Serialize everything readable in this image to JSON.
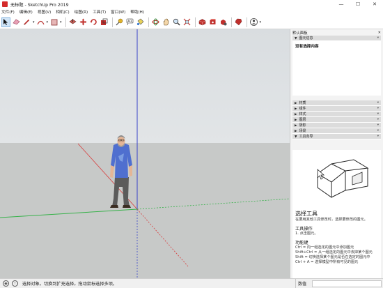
{
  "window": {
    "title": "无标题 - SketchUp Pro 2019",
    "controls": {
      "minimize": "—",
      "maximize": "☐",
      "close": "✕"
    }
  },
  "menu": [
    "文件(F)",
    "编辑(E)",
    "视图(V)",
    "相机(C)",
    "绘图(R)",
    "工具(T)",
    "窗口(W)",
    "帮助(H)"
  ],
  "toolbar": {
    "tools": [
      "select-icon",
      "eraser-icon",
      "pencil-icon",
      "arc-icon",
      "rectangle-icon",
      "push-pull-icon",
      "move-icon",
      "rotate-icon",
      "scale-icon",
      "offset-icon",
      "tape-measure-icon",
      "text-icon",
      "paint-bucket-icon",
      "orbit-icon",
      "pan-icon",
      "zoom-icon",
      "zoom-extents-icon",
      "warehouse-icon",
      "extension-warehouse-icon",
      "extension-manager-icon",
      "ruby-icon",
      "account-icon"
    ]
  },
  "tray": {
    "title": "默认面板",
    "entity_info": {
      "header": "图元信息",
      "body": "没有选择内容"
    },
    "panels": [
      "材质",
      "组件",
      "样式",
      "图层",
      "阴影",
      "场景",
      "工具向导"
    ],
    "instructor": {
      "title": "选择工具",
      "intro": "在要用其他工具修改时，选择要修改的图元。",
      "op_heading": "工具操作",
      "op_item": "1. 点击图元。",
      "keys_heading": "功能键",
      "keys": [
        "Ctrl = 向一组选定的图元中添加图元",
        "Shift+Ctrl = 从一组选定的图元中去掉某个图元",
        "Shift = 切换选择某个图元是否在选定的图元中",
        "Ctrl + A = 选择模型中所有可见的图元"
      ]
    }
  },
  "status": {
    "text": "选择对象。切换到扩充选择。拖动鼠标选择多项。",
    "measurements_label": "数值",
    "measurements_value": ""
  },
  "colors": {
    "axis_red": "#d93a3a",
    "axis_green": "#37b24a",
    "axis_blue": "#3a44c8",
    "ground": "#c7c9c8",
    "sky": "#dfe2e4"
  }
}
